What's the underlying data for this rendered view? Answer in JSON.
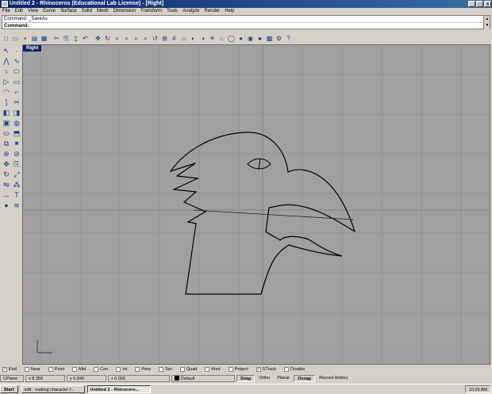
{
  "window": {
    "title": "Untitled 2 - Rhinoceros (Educational Lab License) - [Right]"
  },
  "menu": [
    "File",
    "Edit",
    "View",
    "Curve",
    "Surface",
    "Solid",
    "Mesh",
    "Dimension",
    "Transform",
    "Tools",
    "Analyze",
    "Render",
    "Help"
  ],
  "command": {
    "history": "Command: _SaveAs",
    "prompt_label": "Command:"
  },
  "viewport": {
    "label": "Right",
    "background": "#a0a0a0",
    "grid_color": "#939393"
  },
  "osnap": {
    "items": [
      {
        "label": "End",
        "checked": true
      },
      {
        "label": "Near",
        "checked": false
      },
      {
        "label": "Point",
        "checked": false
      },
      {
        "label": "Mid",
        "checked": false
      },
      {
        "label": "Cen",
        "checked": false
      },
      {
        "label": "Int",
        "checked": false
      },
      {
        "label": "Perp",
        "checked": false
      },
      {
        "label": "Tan",
        "checked": false
      },
      {
        "label": "Quad",
        "checked": false
      },
      {
        "label": "Knot",
        "checked": false
      },
      {
        "label": "Project",
        "checked": false
      },
      {
        "label": "STrack",
        "checked": true
      },
      {
        "label": "Disable",
        "checked": false
      }
    ]
  },
  "status": {
    "cplane": "CPlane",
    "x": "x 8.359",
    "y": "y 6.846",
    "z": "z 0.000",
    "layer": "Default",
    "toggles": [
      {
        "label": "Snap",
        "on": true
      },
      {
        "label": "Ortho",
        "on": false
      },
      {
        "label": "Planar",
        "on": false
      },
      {
        "label": "Osnap",
        "on": true
      },
      {
        "label": "Record History",
        "on": false
      }
    ]
  },
  "taskbar": {
    "start": "Start",
    "items": [
      "edit : making character f...",
      "Untitled 2 - Rhinocero..."
    ],
    "clock": "10:29 AM"
  }
}
